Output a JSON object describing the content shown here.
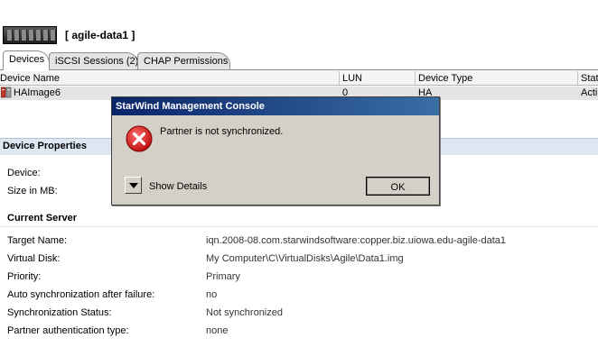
{
  "header": {
    "server_name": "[ agile-data1 ]"
  },
  "tabs": [
    {
      "label": "Devices"
    },
    {
      "label": "iSCSI Sessions (2)"
    },
    {
      "label": "CHAP Permissions"
    }
  ],
  "device_list": {
    "columns": [
      "Device Name",
      "LUN",
      "Device Type",
      "Stat"
    ],
    "rows": [
      {
        "name": "HAImage6",
        "lun": "0",
        "type": "HA",
        "status": "Acti"
      }
    ]
  },
  "properties": {
    "title": "Device Properties",
    "device_label": "Device:",
    "size_label": "Size in MB:",
    "current_server": {
      "title": "Current Server",
      "fields": [
        {
          "label": "Target Name:",
          "value": "iqn.2008-08.com.starwindsoftware:copper.biz.uiowa.edu-agile-data1"
        },
        {
          "label": "Virtual Disk:",
          "value": "My Computer\\C\\VirtualDisks\\Agile\\Data1.img"
        },
        {
          "label": "Priority:",
          "value": "Primary"
        },
        {
          "label": "Auto synchronization after failure:",
          "value": "no"
        },
        {
          "label": "Synchronization Status:",
          "value": "Not synchronized"
        },
        {
          "label": "Partner authentication type:",
          "value": "none"
        }
      ]
    }
  },
  "dialog": {
    "title": "StarWind Management Console",
    "message": "Partner is not synchronized.",
    "show_details_label": "Show Details",
    "ok_label": "OK",
    "icon": "error-icon"
  },
  "colors": {
    "dialog_title_start": "#0a246a",
    "dialog_title_end": "#3a6ea5",
    "error_red": "#d21f1f",
    "props_header": "#dce7f2"
  }
}
